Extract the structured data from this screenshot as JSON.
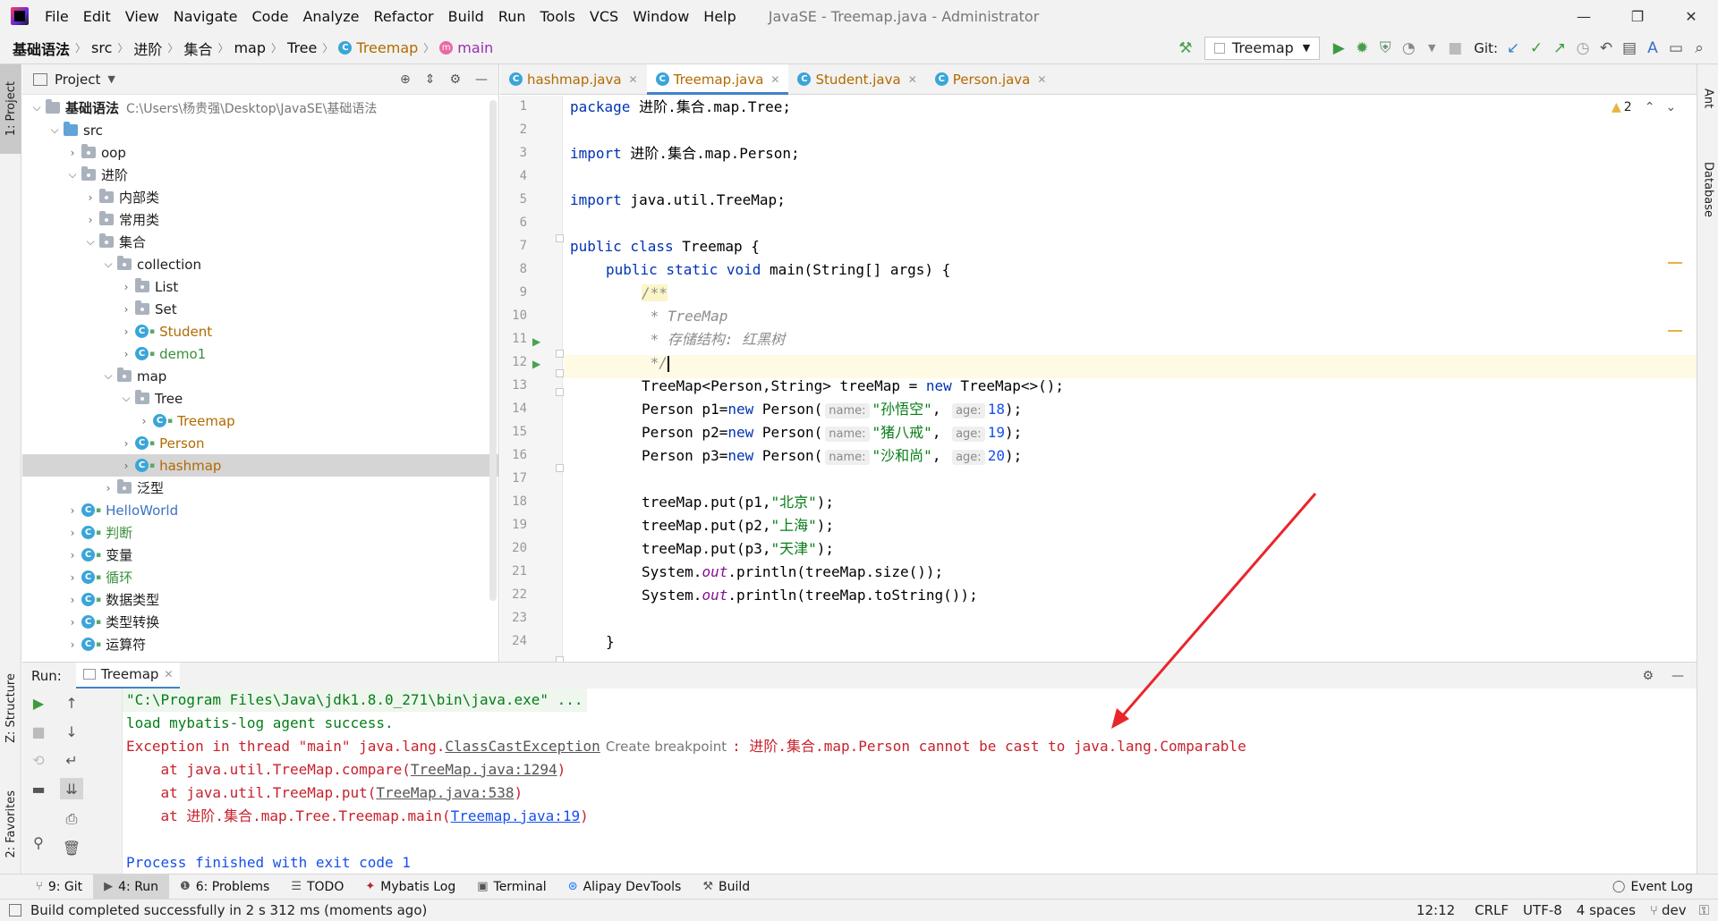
{
  "menubar": {
    "items": [
      "File",
      "Edit",
      "View",
      "Navigate",
      "Code",
      "Analyze",
      "Refactor",
      "Build",
      "Run",
      "Tools",
      "VCS",
      "Window",
      "Help"
    ],
    "window_title": "JavaSE - Treemap.java - Administrator",
    "controls": {
      "minimize": "—",
      "restore": "❐",
      "close": "✕"
    }
  },
  "breadcrumb": {
    "items": [
      "基础语法",
      "src",
      "进阶",
      "集合",
      "map",
      "Tree",
      "Treemap",
      "main"
    ]
  },
  "toolbar": {
    "run_config": "Treemap",
    "git_label": "Git:"
  },
  "left_strip": {
    "project_tab": "1: Project",
    "structure_tab": "Z: Structure",
    "favorites_tab": "2: Favorites"
  },
  "right_strip": {
    "ant_tab": "Ant",
    "database_tab": "Database"
  },
  "project": {
    "title": "Project",
    "root_name": "基础语法",
    "root_path": "C:\\Users\\杨贵强\\Desktop\\JavaSE\\基础语法",
    "nodes": {
      "src": "src",
      "oop": "oop",
      "jinjie": "进阶",
      "neibulei": "内部类",
      "changyonglei": "常用类",
      "jihe": "集合",
      "collection": "collection",
      "list": "List",
      "set": "Set",
      "student": "Student",
      "demo1": "demo1",
      "map": "map",
      "tree": "Tree",
      "treemap": "Treemap",
      "person": "Person",
      "hashmap": "hashmap",
      "fanxing": "泛型",
      "helloworld": "HelloWorld",
      "panduan": "判断",
      "bianliang": "变量",
      "xunhuan": "循环",
      "shujuleixing": "数据类型",
      "leixingzhuanhuan": "类型转换",
      "yunsuanfu": "运算符"
    }
  },
  "editor": {
    "tabs": [
      "hashmap.java",
      "Treemap.java",
      "Student.java",
      "Person.java"
    ],
    "active_tab": "Treemap.java",
    "warnings": "2",
    "line_numbers": [
      "1",
      "2",
      "3",
      "4",
      "5",
      "6",
      "7",
      "8",
      "9",
      "10",
      "11",
      "12",
      "13",
      "14",
      "15",
      "16",
      "17",
      "18",
      "19",
      "20",
      "21",
      "22",
      "23",
      "24"
    ],
    "code": {
      "l1_kw": "package",
      "l1_rest": " 进阶.集合.map.Tree;",
      "l3_kw": "import",
      "l3_rest": " 进阶.集合.map.Person;",
      "l5_kw": "import",
      "l5_rest": " java.util.TreeMap;",
      "l7_kw": "public class",
      "l7_rest": " Treemap {",
      "l8_kw": "public static void",
      "l8_rest": " main(String[] args) {",
      "l9": "/**",
      "l10": " * TreeMap",
      "l11": " * 存储结构: 红黑树",
      "l12": " */",
      "l13_a": "TreeMap<Person,String> treeMap = ",
      "l13_kw": "new",
      "l13_b": " TreeMap<>();",
      "l14_a": "Person p1=",
      "l15_a": "Person p2=",
      "l16_a": "Person p3=",
      "new_kw": "new",
      "person_call": " Person(",
      "hint_name": "name:",
      "hint_age": "age:",
      "s14": "\"孙悟空\"",
      "s15": "\"猪八戒\"",
      "s16": "\"沙和尚\"",
      "n14": "18",
      "n15": "19",
      "n16": "20",
      "close_call": ");",
      "comma": ", ",
      "put_a": "treeMap.put(p1,",
      "put_b": "treeMap.put(p2,",
      "put_c": "treeMap.put(p3,",
      "v18": "\"北京\"",
      "v19": "\"上海\"",
      "v20": "\"天津\"",
      "l21_a": "System.",
      "out": "out",
      "l21_b": ".println(treeMap.size());",
      "l22_b": ".println(treeMap.toString());",
      "l24": "}"
    }
  },
  "run": {
    "label": "Run:",
    "tab": "Treemap",
    "console": {
      "line1": "\"C:\\Program Files\\Java\\jdk1.8.0_271\\bin\\java.exe\" ...",
      "line2": "load mybatis-log agent success.",
      "line3_a": "Exception in thread \"main\" java.lang.",
      "line3_link": "ClassCastException",
      "line3_hint": "Create breakpoint",
      "line3_b": ": 进阶.集合.map.Person cannot be cast to java.lang.Comparable",
      "line4_a": "    at java.util.TreeMap.compare(",
      "line4_link": "TreeMap.java:1294",
      "line5_a": "    at java.util.TreeMap.put(",
      "line5_link": "TreeMap.java:538",
      "line6_a": "    at 进阶.集合.map.Tree.Treemap.main(",
      "line6_link": "Treemap.java:19",
      "close_paren": ")",
      "line8": "Process finished with exit code 1"
    }
  },
  "bottom_tabs": {
    "git": "9: Git",
    "run": "4: Run",
    "problems": "6: Problems",
    "todo": "TODO",
    "mybatis": "Mybatis Log",
    "terminal": "Terminal",
    "alipay": "Alipay DevTools",
    "build": "Build",
    "event_log": "Event Log"
  },
  "status": {
    "message": "Build completed successfully in 2 s 312 ms (moments ago)",
    "position": "12:12",
    "line_sep": "CRLF",
    "encoding": "UTF-8",
    "indent": "4 spaces",
    "branch": "dev"
  },
  "colors": {
    "accent": "#4083c9",
    "keyword": "#0033b3",
    "string": "#067d17",
    "error": "#c7222d",
    "annotation_arrow": "#e8262b"
  }
}
